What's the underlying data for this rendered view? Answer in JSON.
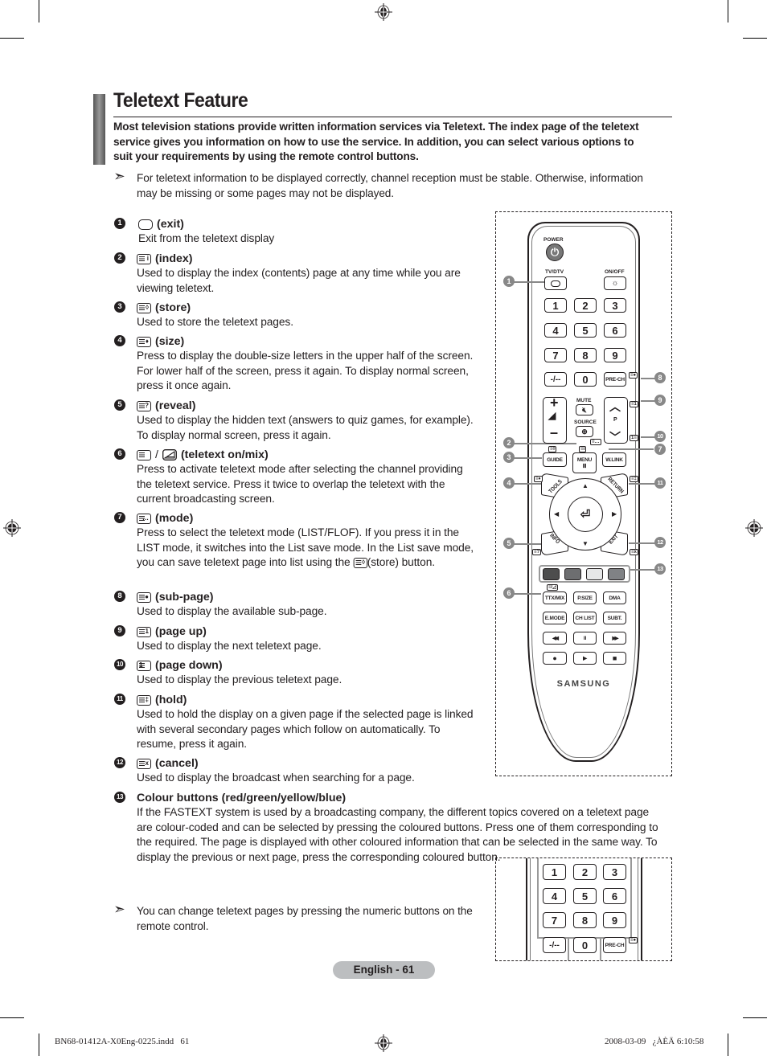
{
  "page": {
    "title": "Teletext Feature",
    "intro": "Most television stations provide written information services via Teletext. The index page of the teletext service gives you information on how to use the service. In addition, you can select various options to suit your requirements by using the remote control buttons.",
    "note_top": "For teletext information to be displayed correctly, channel reception must be stable. Otherwise, information may be missing or some pages may not be displayed.",
    "note_bottom": "You can change teletext pages by pressing the numeric buttons on the remote control.",
    "arrow_glyph": "➣"
  },
  "items": [
    {
      "num": "1",
      "icon": "exit-icon",
      "icon_text": "",
      "label": "(exit)",
      "desc": "Exit from the teletext display"
    },
    {
      "num": "2",
      "icon": "index-icon",
      "icon_text": "i",
      "label": "(index)",
      "desc": "Used to display the index (contents) page at any time while you are viewing teletext."
    },
    {
      "num": "3",
      "icon": "store-icon",
      "icon_text": "◊",
      "label": "(store)",
      "desc": "Used to store the teletext pages."
    },
    {
      "num": "4",
      "icon": "size-icon",
      "icon_text": "♦",
      "label": "(size)",
      "desc": "Press to display the double-size letters in the upper half of the screen. For lower half of the screen, press it again. To display normal screen, press it once again."
    },
    {
      "num": "5",
      "icon": "reveal-icon",
      "icon_text": "?",
      "label": "(reveal)",
      "desc": "Used to display the hidden text (answers to quiz games, for example). To display normal screen, press it again."
    },
    {
      "num": "6",
      "icon": "teletext-mix-icon",
      "icon_text": "",
      "label": "(teletext on/mix)",
      "desc": "Press to activate teletext mode after selecting the channel providing the teletext service. Press it twice to overlap the teletext with the current broadcasting screen."
    },
    {
      "num": "7",
      "icon": "mode-icon",
      "icon_text": "…",
      "label": "(mode)",
      "desc": "Press to select the teletext mode (LIST/FLOF). If you press it in the LIST mode, it switches into the List save mode. In the List save mode, you can save teletext page into list using the",
      "desc_suffix": "(store) button."
    },
    {
      "num": "8",
      "icon": "sub-page-icon",
      "icon_text": "●",
      "label": "(sub-page)",
      "desc": "Used to display the available sub-page."
    },
    {
      "num": "9",
      "icon": "page-up-icon",
      "icon_text": "1",
      "label": "(page up)",
      "desc": "Used to display the next teletext page."
    },
    {
      "num": "10",
      "icon": "page-down-icon",
      "icon_text": "1",
      "label": "(page down)",
      "desc": "Used to display the previous teletext page."
    },
    {
      "num": "11",
      "icon": "hold-icon",
      "icon_text": "‡",
      "label": "(hold)",
      "desc": "Used to hold the display on a given page if the selected page is linked with several secondary pages which follow on automatically. To resume, press it again."
    },
    {
      "num": "12",
      "icon": "cancel-icon",
      "icon_text": "x",
      "label": "(cancel)",
      "desc": "Used to display the broadcast when searching for a page."
    },
    {
      "num": "13",
      "icon": "",
      "icon_text": "",
      "label": "Colour buttons (red/green/yellow/blue)",
      "desc": "If the FASTEXT system is used by a broadcasting company, the different topics covered on a teletext page are colour-coded and can be selected by pressing the coloured buttons. Press one of them corresponding to the required. The page is displayed with other coloured information that can be selected in the same way. To display the previous or next page, press the corresponding coloured button."
    }
  ],
  "remote": {
    "power_label": "POWER",
    "tvdtv_label": "TV/DTV",
    "onoff_label": "ON/OFF",
    "digits": [
      "1",
      "2",
      "3",
      "4",
      "5",
      "6",
      "7",
      "8",
      "9"
    ],
    "dash_label": "-/--",
    "zero_label": "0",
    "prech_label": "PRE-CH",
    "mute_label": "MUTE",
    "source_label": "SOURCE",
    "p_label": "P",
    "vol_plus": "+",
    "vol_minus": "–",
    "ch_up": "^",
    "ch_down": "v",
    "guide_label": "GUIDE",
    "menu_label": "MENU",
    "wlink_label": "W.LINK",
    "tools_label": "TOOLS",
    "return_label": "RETURN",
    "info_label": "INFO",
    "exit_label": "EXIT",
    "ttxmix_label": "TTX/MIX",
    "psize_label": "P.SIZE",
    "dma_label": "DMA",
    "emode_label": "E.MODE",
    "chlist_label": "CH LIST",
    "subt_label": "SUBT.",
    "rew_glyph": "◀◀",
    "pause_glyph": "II",
    "ff_glyph": "▶▶",
    "rec_glyph": "●",
    "play_glyph": "▶",
    "stop_glyph": "■",
    "brand": "SAMSUNG",
    "color_buttons": [
      "#4d4d4d",
      "#6d6e70",
      "#e6e7e8",
      "#808285"
    ],
    "callouts": [
      "1",
      "2",
      "3",
      "4",
      "5",
      "6",
      "7",
      "8",
      "9",
      "10",
      "11",
      "12",
      "13"
    ]
  },
  "footer": {
    "page_label": "English - 61",
    "imprint_file": "BN68-01412A-X0Eng-0225.indd   61",
    "imprint_date": "2008-03-09   ¿ÀÈÄ 6:10:58"
  }
}
